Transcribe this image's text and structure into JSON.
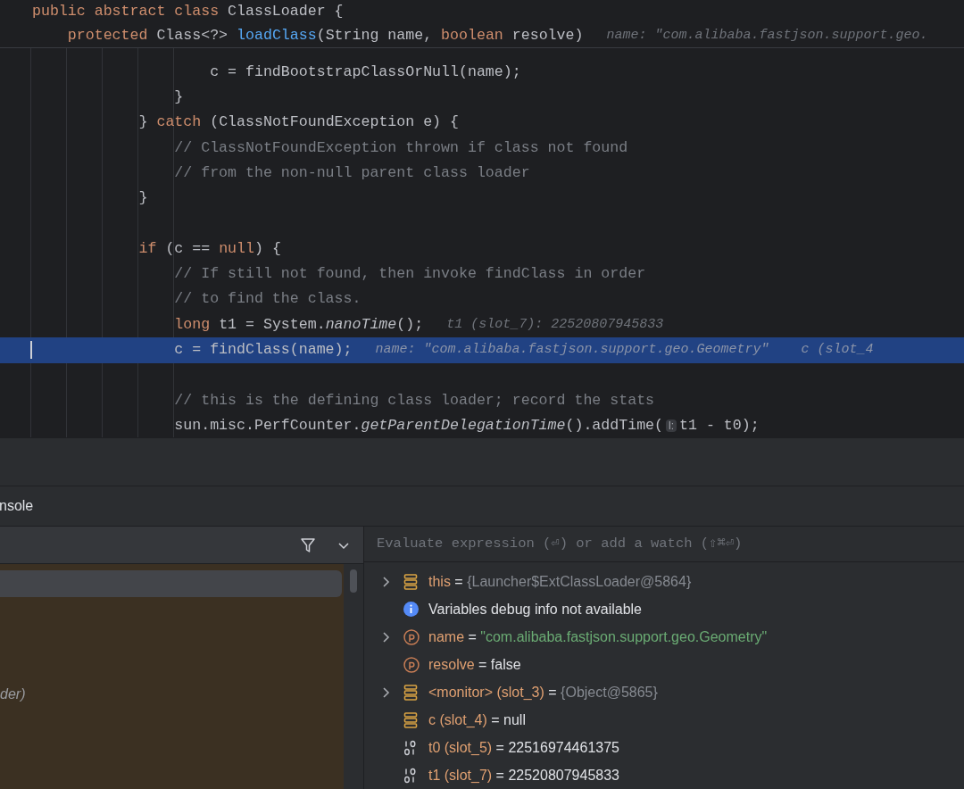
{
  "editor": {
    "header_lines": [
      {
        "selected": false,
        "tokens": [
          {
            "kind": "keyword",
            "text": "public abstract class"
          },
          {
            "kind": "plain",
            "text": " ClassLoader {"
          }
        ]
      },
      {
        "selected": false,
        "tokens": [
          {
            "kind": "keyword",
            "text": "    protected"
          },
          {
            "kind": "plain",
            "text": " Class<?> "
          },
          {
            "kind": "function",
            "text": "loadClass"
          },
          {
            "kind": "plain",
            "text": "(String name, "
          },
          {
            "kind": "keyword",
            "text": "boolean"
          },
          {
            "kind": "plain",
            "text": " resolve)"
          }
        ],
        "hint": "name: \"com.alibaba.fastjson.support.geo."
      }
    ],
    "lines": [
      {
        "selected": false,
        "tokens": [
          {
            "kind": "plain",
            "text": "                    c = findBootstrapClassOrNull(name);"
          }
        ]
      },
      {
        "selected": false,
        "tokens": [
          {
            "kind": "plain",
            "text": "                }"
          }
        ]
      },
      {
        "selected": false,
        "tokens": [
          {
            "kind": "plain",
            "text": "            } "
          },
          {
            "kind": "keyword",
            "text": "catch"
          },
          {
            "kind": "plain",
            "text": " (ClassNotFoundException e) {"
          }
        ]
      },
      {
        "selected": false,
        "tokens": [
          {
            "kind": "comment",
            "text": "                // ClassNotFoundException thrown if class not found"
          }
        ]
      },
      {
        "selected": false,
        "tokens": [
          {
            "kind": "comment",
            "text": "                // from the non-null parent class loader"
          }
        ]
      },
      {
        "selected": false,
        "tokens": [
          {
            "kind": "plain",
            "text": "            }"
          }
        ]
      },
      {
        "selected": false
      },
      {
        "selected": false,
        "tokens": [
          {
            "kind": "keyword",
            "text": "            if"
          },
          {
            "kind": "plain",
            "text": " (c == "
          },
          {
            "kind": "keyword",
            "text": "null"
          },
          {
            "kind": "plain",
            "text": ") {"
          }
        ]
      },
      {
        "selected": false,
        "tokens": [
          {
            "kind": "comment",
            "text": "                // If still not found, then invoke findClass in order"
          }
        ]
      },
      {
        "selected": false,
        "tokens": [
          {
            "kind": "comment",
            "text": "                // to find the class."
          }
        ]
      },
      {
        "selected": false,
        "tokens": [
          {
            "kind": "keyword",
            "text": "                long"
          },
          {
            "kind": "plain",
            "text": " t1 = System."
          },
          {
            "kind": "italic",
            "text": "nanoTime"
          },
          {
            "kind": "plain",
            "text": "();"
          }
        ],
        "hint": "t1 (slot_7): 22520807945833"
      },
      {
        "selected": true,
        "tokens": [
          {
            "kind": "plain",
            "text": "                c = findClass(name);"
          }
        ],
        "hint": "name: \"com.alibaba.fastjson.support.geo.Geometry\"    c (slot_4"
      },
      {
        "selected": false
      },
      {
        "selected": false,
        "tokens": [
          {
            "kind": "comment",
            "text": "                // this is the defining class loader; record the stats"
          }
        ]
      },
      {
        "selected": false,
        "tokens": [
          {
            "kind": "plain",
            "text": "                sun.misc.PerfCounter."
          },
          {
            "kind": "italic",
            "text": "getParentDelegationTime"
          },
          {
            "kind": "plain",
            "text": "().addTime("
          },
          {
            "kind": "param_hint",
            "text": "l:"
          },
          {
            "kind": "plain",
            "text": "t1 - t0);"
          }
        ]
      }
    ]
  },
  "tool_window": {
    "tab": "nsole",
    "frames": [
      {
        "selected": true
      },
      {
        "selected": false
      },
      {
        "selected": false
      },
      {
        "selected": false
      },
      {
        "selected": false,
        "label": "der)"
      }
    ],
    "evaluate": {
      "placeholder": "Evaluate expression (⏎) or add a watch (⇧⌘⏎)"
    },
    "variables": [
      {
        "kind": "object",
        "expandable": true,
        "name": "this",
        "equals": "=",
        "ref": "{Launcher$ExtClassLoader@5864}"
      },
      {
        "kind": "info",
        "expandable": false,
        "name": "Variables debug info not available"
      },
      {
        "kind": "param",
        "expandable": true,
        "name": "name",
        "equals": "=",
        "string": "\"com.alibaba.fastjson.support.geo.Geometry\""
      },
      {
        "kind": "param",
        "expandable": false,
        "name": "resolve",
        "equals": "=",
        "value": "false"
      },
      {
        "kind": "object",
        "expandable": true,
        "name": "<monitor> (slot_3)",
        "equals": "=",
        "ref": "{Object@5865}"
      },
      {
        "kind": "object",
        "expandable": false,
        "name": "c (slot_4)",
        "equals": "=",
        "value": "null"
      },
      {
        "kind": "primitive",
        "expandable": false,
        "name": "t0 (slot_5)",
        "equals": "=",
        "value": "22516974461375"
      },
      {
        "kind": "primitive",
        "expandable": false,
        "name": "t1 (slot_7)",
        "equals": "=",
        "value": "22520807945833"
      }
    ]
  }
}
